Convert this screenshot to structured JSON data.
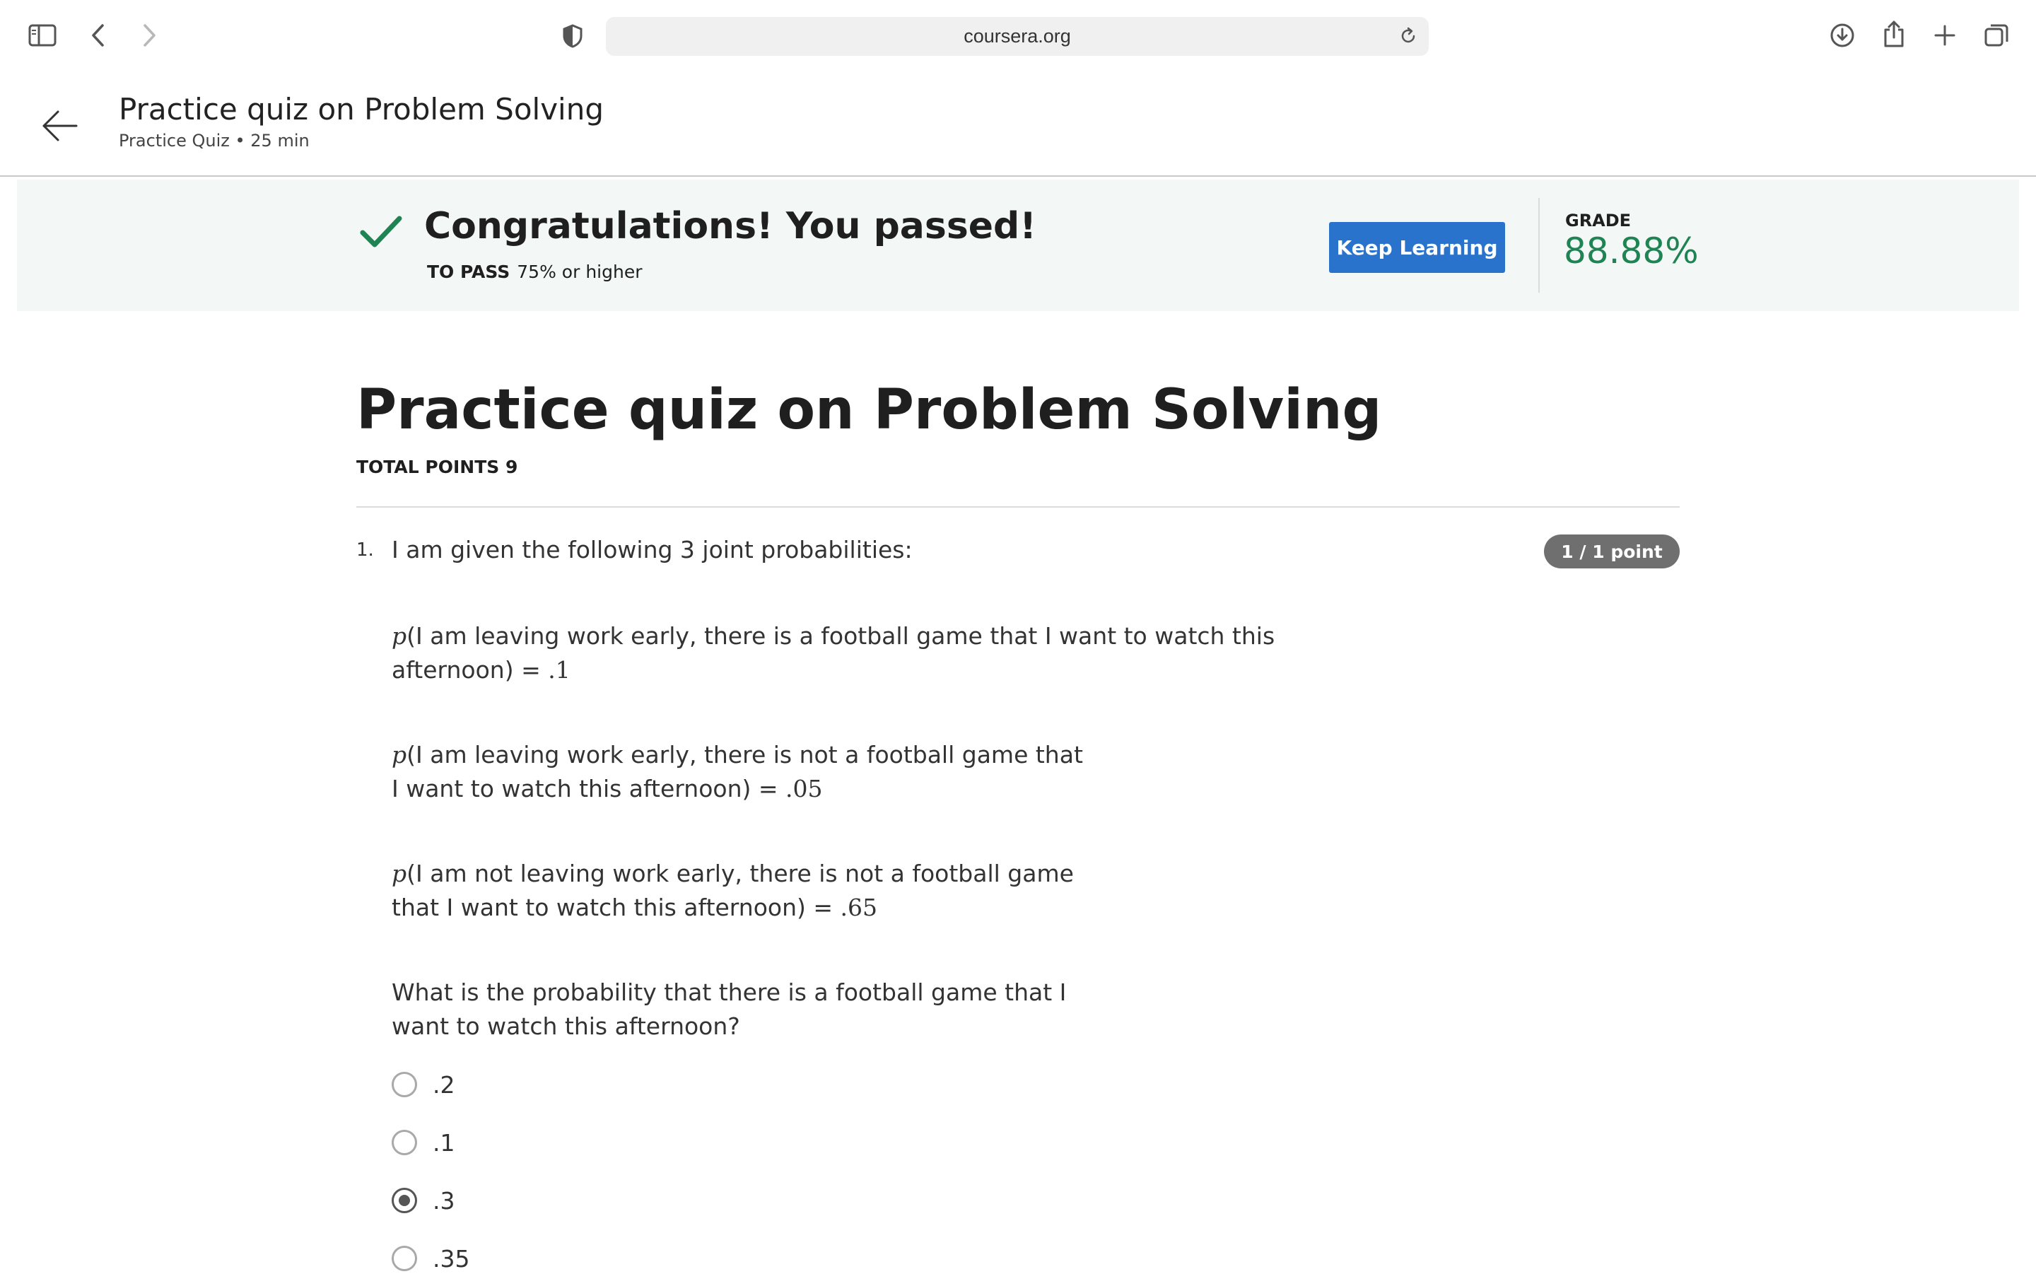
{
  "browser": {
    "url": "coursera.org",
    "icons": {
      "sidebar": "sidebar-icon",
      "back": "chevron-left-icon",
      "forward": "chevron-right-icon",
      "privacy": "shield-icon",
      "reload": "reload-icon",
      "downloads": "download-icon",
      "share": "share-icon",
      "new_tab": "plus-icon",
      "tabs": "tabs-overview-icon"
    }
  },
  "header": {
    "title": "Practice quiz on Problem Solving",
    "subtitle": "Practice Quiz • 25 min"
  },
  "result": {
    "message": "Congratulations! You passed!",
    "to_pass_label": "TO PASS",
    "to_pass_value": "75% or higher",
    "keep_learning_label": "Keep Learning",
    "grade_label": "GRADE",
    "grade_value": "88.88%",
    "colors": {
      "accent": "#2a73cc",
      "success": "#1f8354",
      "banner_bg": "#f3f8f6"
    }
  },
  "quiz": {
    "title": "Practice quiz on Problem Solving",
    "total_points": "TOTAL POINTS 9",
    "questions": [
      {
        "number": "1.",
        "intro": "I am given the following 3 joint probabilities:",
        "points": "1 / 1 point",
        "statements": [
          {
            "var": "p",
            "line1": "(I am leaving work early, there is a football game that I want to watch this",
            "line2": "afternoon) = ",
            "value": ".1"
          },
          {
            "var": "p",
            "line1": "(I am leaving work early, there is not a football game that",
            "line2": "I want to watch this afternoon) = ",
            "value": ".05"
          },
          {
            "var": "p",
            "line1": "(I am not leaving work early, there is not a football game",
            "line2": "that I want to watch this afternoon) = ",
            "value": ".65"
          }
        ],
        "prompt_line1": "What is the probability that there is a football game that I",
        "prompt_line2": "want to watch this afternoon?",
        "options": [
          {
            "label": ".2",
            "selected": false
          },
          {
            "label": ".1",
            "selected": false
          },
          {
            "label": ".3",
            "selected": true
          },
          {
            "label": ".35",
            "selected": false
          }
        ]
      }
    ]
  }
}
